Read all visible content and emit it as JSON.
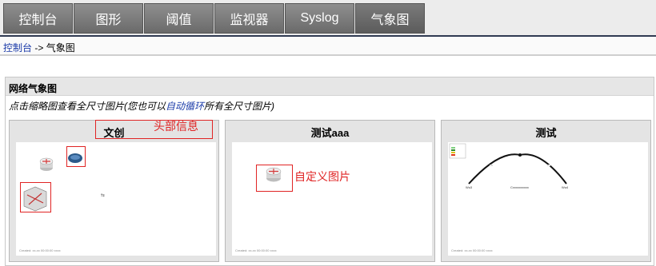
{
  "nav": {
    "tabs": [
      "控制台",
      "图形",
      "阈值",
      "监视器",
      "Syslog",
      "气象图"
    ]
  },
  "breadcrumb": {
    "home": "控制台",
    "separator": " -> ",
    "current": "气象图"
  },
  "panel": {
    "title": "网络气象图",
    "hint_prefix": "点击缩略图查看全尺寸图片(您也可以",
    "hint_link": "自动循环",
    "hint_suffix": "所有全尺寸图片)"
  },
  "cards": [
    {
      "title": "文创",
      "annotation": "头部信息",
      "footer": "Created: xx-xx 00:00:00 xxxx"
    },
    {
      "title": "测试aaa",
      "annotation": "自定义图片",
      "footer": "Created: xx-xx 00:00:00 xxxx"
    },
    {
      "title": "测试",
      "footer": "Created: xx-xx 00:00:00 xxxx",
      "nodes": [
        "Wu3",
        "Cxxxxxxxxxx",
        "Wu4"
      ]
    }
  ],
  "colors": {
    "annotation": "#e02424",
    "link": "#1a3aa8",
    "tab_bg": "#7a7a7a"
  }
}
